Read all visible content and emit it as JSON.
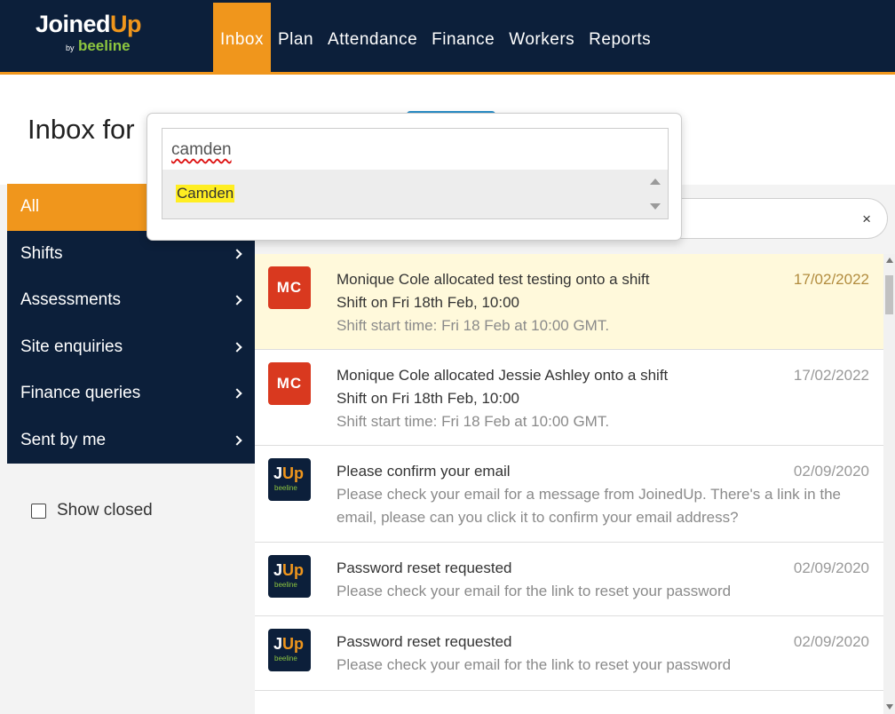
{
  "brand": {
    "name_a": "Joined",
    "name_b": "Up",
    "by": "by",
    "partner": "beeline"
  },
  "nav": [
    {
      "label": "Inbox",
      "active": true
    },
    {
      "label": "Plan"
    },
    {
      "label": "Attendance"
    },
    {
      "label": "Finance"
    },
    {
      "label": "Workers"
    },
    {
      "label": "Reports"
    }
  ],
  "page": {
    "title": "Inbox for"
  },
  "sidebar": {
    "items": [
      {
        "label": "All",
        "active": true
      },
      {
        "label": "Shifts"
      },
      {
        "label": "Assessments"
      },
      {
        "label": "Site enquiries"
      },
      {
        "label": "Finance queries"
      },
      {
        "label": "Sent by me"
      }
    ],
    "show_closed_label": "Show closed"
  },
  "search": {
    "clear_symbol": "×"
  },
  "dropdown": {
    "input_value": "camden",
    "options": [
      "Camden"
    ]
  },
  "messages": [
    {
      "avatar": "MC",
      "title": "Monique Cole allocated test testing onto a shift",
      "line": "Shift on Fri 18th Feb, 10:00",
      "body": "Shift start time: Fri 18 Feb at 10:00 GMT.",
      "date": "17/02/2022",
      "highlight": true
    },
    {
      "avatar": "MC",
      "title": "Monique Cole allocated Jessie Ashley onto a shift",
      "line": "Shift on Fri 18th Feb, 10:00",
      "body": "Shift start time: Fri 18 Feb at 10:00 GMT.",
      "date": "17/02/2022"
    },
    {
      "avatar_logo": {
        "a": "J",
        "b": "Up",
        "sub": "beeline"
      },
      "title": "Please confirm your email",
      "body": "Please check your email for a message from JoinedUp. There's a link in the email, please can you click it to confirm your email address?",
      "date": "02/09/2020"
    },
    {
      "avatar_logo": {
        "a": "J",
        "b": "Up",
        "sub": "beeline"
      },
      "title": "Password reset requested",
      "body": "Please check your email for the link to reset your password",
      "date": "02/09/2020"
    },
    {
      "avatar_logo": {
        "a": "J",
        "b": "Up",
        "sub": "beeline"
      },
      "title": "Password reset requested",
      "body": "Please check your email for the link to reset your password",
      "date": "02/09/2020"
    }
  ],
  "colors": {
    "navy": "#0c1f3a",
    "orange": "#f0961c",
    "red": "#d9391f",
    "green": "#8dc63f"
  }
}
